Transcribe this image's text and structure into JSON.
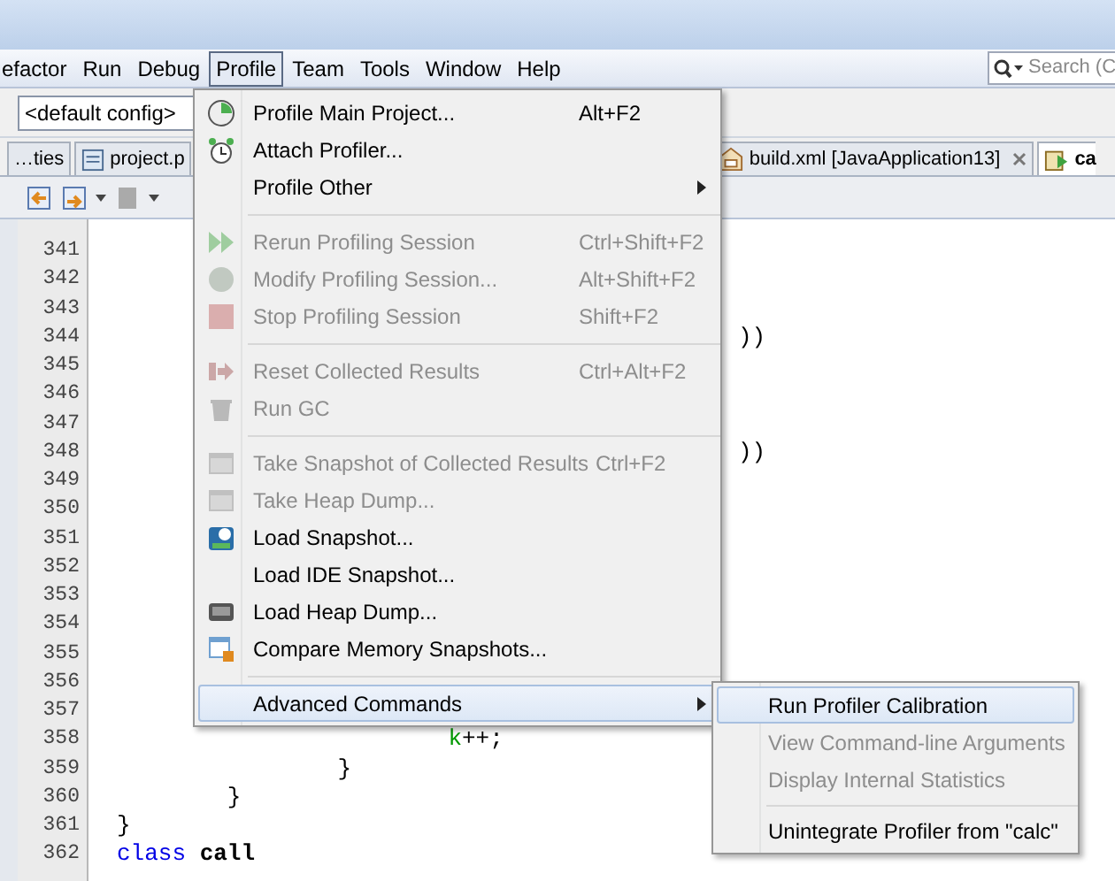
{
  "menubar": [
    {
      "label": "efactor",
      "selected": false
    },
    {
      "label": "Run",
      "selected": false
    },
    {
      "label": "Debug",
      "selected": false
    },
    {
      "label": "Profile",
      "selected": true
    },
    {
      "label": "Team",
      "selected": false
    },
    {
      "label": "Tools",
      "selected": false
    },
    {
      "label": "Window",
      "selected": false
    },
    {
      "label": "Help",
      "selected": false
    }
  ],
  "search": {
    "placeholder": "Search (C"
  },
  "config": {
    "value": "<default config>"
  },
  "tabs": [
    {
      "label": "…ties",
      "selected": false,
      "closable": false
    },
    {
      "label": "project.p",
      "selected": false,
      "closable": false
    },
    {
      "label": "build.xml [JavaApplication13]",
      "selected": false,
      "closable": true
    },
    {
      "label": "ca",
      "selected": true,
      "closable": false
    }
  ],
  "code_lines": [
    {
      "number": "341"
    },
    {
      "number": "342"
    },
    {
      "number": "343"
    },
    {
      "number": "344",
      "tokens": [
        {
          "text": "))",
          "kind": "plain"
        }
      ]
    },
    {
      "number": "345"
    },
    {
      "number": "346"
    },
    {
      "number": "347"
    },
    {
      "number": "348",
      "tokens": [
        {
          "text": "))",
          "kind": "plain"
        }
      ]
    },
    {
      "number": "349"
    },
    {
      "number": "350"
    },
    {
      "number": "351"
    },
    {
      "number": "352"
    },
    {
      "number": "353"
    },
    {
      "number": "354"
    },
    {
      "number": "355"
    },
    {
      "number": "356"
    },
    {
      "number": "357"
    },
    {
      "number": "358",
      "tokens": [
        {
          "text": "k",
          "kind": "field"
        },
        {
          "text": "++;",
          "kind": "plain"
        }
      ]
    },
    {
      "number": "359",
      "tokens": [
        {
          "text": "}",
          "kind": "plain"
        }
      ]
    },
    {
      "number": "360",
      "tokens": [
        {
          "text": "}",
          "kind": "plain"
        }
      ]
    },
    {
      "number": "361",
      "tokens": [
        {
          "text": "}",
          "kind": "plain"
        }
      ]
    },
    {
      "number": "362",
      "tokens": [
        {
          "text": "class",
          "kind": "keyword"
        },
        {
          "text": "call",
          "kind": "bold"
        }
      ]
    }
  ],
  "profile_menu": [
    {
      "kind": "item",
      "label": "Profile Main Project...",
      "shortcut": "Alt+F2",
      "disabled": false,
      "submenu": false,
      "selected": false
    },
    {
      "kind": "item",
      "label": "Attach Profiler...",
      "disabled": false,
      "submenu": false,
      "selected": false
    },
    {
      "kind": "item",
      "label": "Profile Other",
      "disabled": false,
      "submenu": true,
      "selected": false
    },
    {
      "kind": "separator"
    },
    {
      "kind": "item",
      "label": "Rerun Profiling Session",
      "shortcut": "Ctrl+Shift+F2",
      "disabled": true,
      "submenu": false,
      "selected": false
    },
    {
      "kind": "item",
      "label": "Modify Profiling Session...",
      "shortcut": "Alt+Shift+F2",
      "disabled": true,
      "submenu": false,
      "selected": false
    },
    {
      "kind": "item",
      "label": "Stop Profiling Session",
      "shortcut": "Shift+F2",
      "disabled": true,
      "submenu": false,
      "selected": false
    },
    {
      "kind": "separator"
    },
    {
      "kind": "item",
      "label": "Reset Collected Results",
      "shortcut": "Ctrl+Alt+F2",
      "disabled": true,
      "submenu": false,
      "selected": false
    },
    {
      "kind": "item",
      "label": "Run GC",
      "disabled": true,
      "submenu": false,
      "selected": false
    },
    {
      "kind": "separator"
    },
    {
      "kind": "item",
      "label": "Take Snapshot of Collected Results",
      "shortcut": "Ctrl+F2",
      "disabled": true,
      "submenu": false,
      "selected": false
    },
    {
      "kind": "item",
      "label": "Take Heap Dump...",
      "disabled": true,
      "submenu": false,
      "selected": false
    },
    {
      "kind": "item",
      "label": "Load Snapshot...",
      "disabled": false,
      "submenu": false,
      "selected": false
    },
    {
      "kind": "item",
      "label": "Load IDE Snapshot...",
      "disabled": false,
      "submenu": false,
      "selected": false
    },
    {
      "kind": "item",
      "label": "Load Heap Dump...",
      "disabled": false,
      "submenu": false,
      "selected": false
    },
    {
      "kind": "item",
      "label": "Compare Memory Snapshots...",
      "disabled": false,
      "submenu": false,
      "selected": false
    },
    {
      "kind": "separator"
    },
    {
      "kind": "item",
      "label": "Advanced Commands",
      "disabled": false,
      "submenu": true,
      "selected": true
    }
  ],
  "advanced_submenu": [
    {
      "kind": "item",
      "label": "Run Profiler Calibration",
      "disabled": false,
      "selected": true
    },
    {
      "kind": "item",
      "label": "View Command-line Arguments",
      "disabled": true,
      "selected": false
    },
    {
      "kind": "item",
      "label": "Display Internal Statistics",
      "disabled": true,
      "selected": false
    },
    {
      "kind": "separator"
    },
    {
      "kind": "item",
      "label": "Unintegrate Profiler from \"calc\"",
      "disabled": false,
      "selected": false
    }
  ]
}
